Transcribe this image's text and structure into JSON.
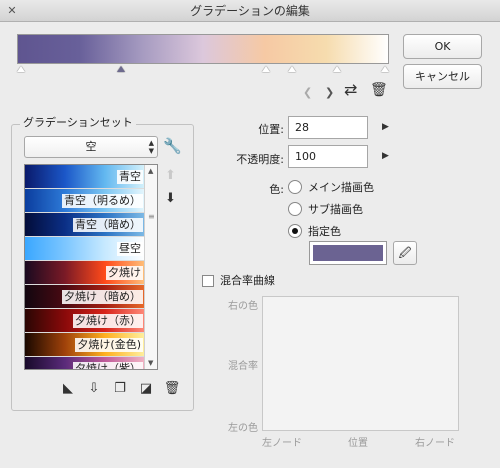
{
  "window": {
    "title": "グラデーションの編集"
  },
  "gradient": {
    "colors": [
      "#5f5590",
      "#68609a",
      "#a59ac0",
      "#dcc8dc",
      "#f6c9a4",
      "#f6dcae",
      "#ffffff"
    ],
    "nodes": [
      0,
      28,
      67,
      74,
      86,
      100
    ],
    "selected_node": 28
  },
  "buttons": {
    "ok": "OK",
    "cancel": "キャンセル"
  },
  "gradient_set": {
    "title": "グラデーションセット",
    "selected": "空",
    "items": [
      {
        "label": "青空",
        "colors": [
          "#0a1a6b",
          "#1b57c8",
          "#63b8f0",
          "#d6f2fb"
        ]
      },
      {
        "label": "青空（明るめ）",
        "colors": [
          "#0b3d9e",
          "#2d7ad8",
          "#7cc6f2",
          "#e6f7fd"
        ]
      },
      {
        "label": "青空（暗め）",
        "colors": [
          "#030d3a",
          "#0b2f86",
          "#2b73c4",
          "#7ebbe6"
        ]
      },
      {
        "label": "昼空",
        "colors": [
          "#3aa7ff",
          "#7cc6ff",
          "#c7e9ff",
          "#ffffff"
        ]
      },
      {
        "label": "夕焼け",
        "colors": [
          "#1a0a20",
          "#7a1a26",
          "#ff4a1a",
          "#ffc07a"
        ]
      },
      {
        "label": "夕焼け（暗め）",
        "colors": [
          "#120610",
          "#4a0a12",
          "#a41e12",
          "#e86a2a"
        ]
      },
      {
        "label": "夕焼け（赤）",
        "colors": [
          "#2a0604",
          "#8a0a0a",
          "#d8231a",
          "#ff8a7a"
        ]
      },
      {
        "label": "夕焼け(金色)",
        "colors": [
          "#1a0800",
          "#a0420a",
          "#ffb020",
          "#fff0a0"
        ]
      },
      {
        "label": "夕焼け（紫）",
        "colors": [
          "#180a2a",
          "#5a2a7a",
          "#c05a9a",
          "#f2b4c4"
        ]
      }
    ]
  },
  "properties": {
    "position_label": "位置:",
    "position_value": "28",
    "opacity_label": "不透明度:",
    "opacity_value": "100",
    "color_label": "色:",
    "color_options": [
      "メイン描画色",
      "サブ描画色",
      "指定色"
    ],
    "selected_color_option": "指定色",
    "specified_color": "#6b6392"
  },
  "curve": {
    "checkbox_label": "混合率曲線",
    "checked": false,
    "y_top": "右の色",
    "y_mid": "混合率",
    "y_bottom": "左の色",
    "x_left": "左ノード",
    "x_mid": "位置",
    "x_right": "右ノード"
  }
}
